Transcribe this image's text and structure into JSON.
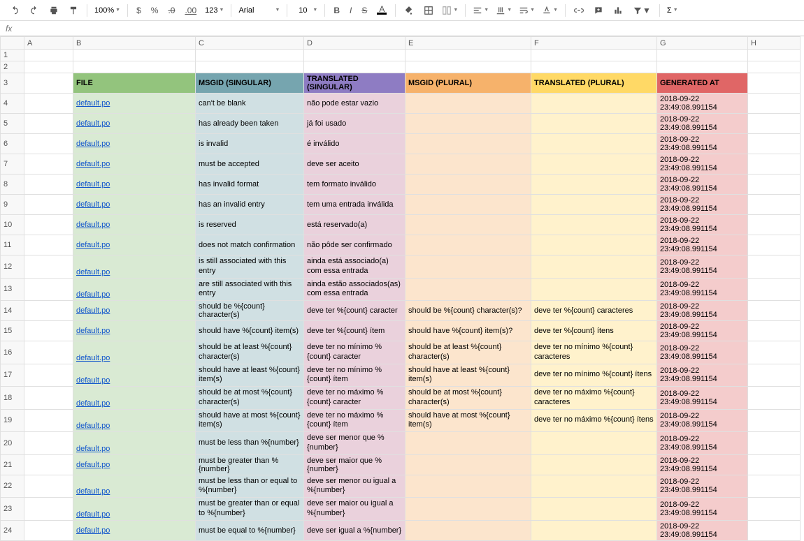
{
  "toolbar": {
    "zoom": "100%",
    "currency": "$",
    "percent": "%",
    "dec_remove": ".0",
    "dec_add": ".00",
    "numfmt": "123",
    "font_name": "Arial",
    "font_size": "10",
    "bold_label": "B",
    "italic_label": "I",
    "strike_label": "S",
    "textcolor_label": "A",
    "formula_label": "Σ"
  },
  "formula_bar": {
    "fx": "fx",
    "value": ""
  },
  "columns": [
    "",
    "A",
    "B",
    "C",
    "D",
    "E",
    "F",
    "G",
    "H"
  ],
  "headers": {
    "file": "FILE",
    "msgid_s": "MSGID (SINGULAR)",
    "trans_s": "TRANSLATED (SINGULAR)",
    "msgid_p": "MSGID (PLURAL)",
    "trans_p": "TRANSLATED (PLURAL)",
    "gen": "GENERATED AT"
  },
  "file_label": "default.po",
  "ts": "2018-09-22 23:49:08.991154",
  "rows": [
    {
      "n": 4,
      "ms": "can't be blank",
      "ts": "não pode estar vazio",
      "mp": "",
      "tp": ""
    },
    {
      "n": 5,
      "ms": "has already been taken",
      "ts": "já foi usado",
      "mp": "",
      "tp": ""
    },
    {
      "n": 6,
      "ms": "is invalid",
      "ts": "é inválido",
      "mp": "",
      "tp": ""
    },
    {
      "n": 7,
      "ms": "must be accepted",
      "ts": "deve ser aceito",
      "mp": "",
      "tp": ""
    },
    {
      "n": 8,
      "ms": "has invalid format",
      "ts": "tem formato inválido",
      "mp": "",
      "tp": ""
    },
    {
      "n": 9,
      "ms": "has an invalid entry",
      "ts": "tem uma entrada inválida",
      "mp": "",
      "tp": ""
    },
    {
      "n": 10,
      "ms": "is reserved",
      "ts": "está reservado(a)",
      "mp": "",
      "tp": ""
    },
    {
      "n": 11,
      "ms": "does not match confirmation",
      "ts": "não pôde ser confirmado",
      "mp": "",
      "tp": ""
    },
    {
      "n": 12,
      "tall": true,
      "ms": "is still associated with this entry",
      "ts": "ainda está associado(a) com essa entrada",
      "mp": "",
      "tp": ""
    },
    {
      "n": 13,
      "tall": true,
      "ms": "are still associated with this entry",
      "ts": "ainda estão associados(as) com essa entrada",
      "mp": "",
      "tp": ""
    },
    {
      "n": 14,
      "ms": "should be %{count} character(s)",
      "ts": "deve ter %{count} caracter",
      "mp": "should be %{count} character(s)?",
      "tp": "deve ter %{count} caracteres"
    },
    {
      "n": 15,
      "ms": "should have %{count} item(s)",
      "ts": "deve ter %{count} ítem",
      "mp": "should have %{count} item(s)?",
      "tp": "deve ter %{count} ítens"
    },
    {
      "n": 16,
      "tall": true,
      "ms": "should be at least %{count} character(s)",
      "ts": "deve ter no mínimo %{count} caracter",
      "mp": "should be at least %{count} character(s)",
      "tp": "deve ter no mínimo %{count} caracteres"
    },
    {
      "n": 17,
      "tall": true,
      "ms": "should have at least %{count} item(s)",
      "ts": "deve ter no mínimo %{count} ítem",
      "mp": "should have at least %{count} item(s)",
      "tp": "deve ter no mínimo %{count} ítens"
    },
    {
      "n": 18,
      "tall": true,
      "ms": "should be at most %{count} character(s)",
      "ts": "deve ter no máximo %{count} caracter",
      "mp": "should be at most %{count} character(s)",
      "tp": "deve ter no máximo %{count} caracteres"
    },
    {
      "n": 19,
      "tall": true,
      "ms": "should have at most %{count} item(s)",
      "ts": "deve ter no máximo %{count} ítem",
      "mp": "should have at most %{count} item(s)",
      "tp": "deve ter no máximo %{count} ítens"
    },
    {
      "n": 20,
      "tall": true,
      "ms": "must be less than %{number}",
      "ts": "deve ser menor que %{number}",
      "mp": "",
      "tp": ""
    },
    {
      "n": 21,
      "ms": "must be greater than %{number}",
      "ts": "deve ser maior que %{number}",
      "mp": "",
      "tp": ""
    },
    {
      "n": 22,
      "tall": true,
      "ms": "must be less than or equal to %{number}",
      "ts": "deve ser menor ou igual a %{number}",
      "mp": "",
      "tp": ""
    },
    {
      "n": 23,
      "tall": true,
      "ms": "must be greater than or equal to %{number}",
      "ts": "deve ser maior ou igual a %{number}",
      "mp": "",
      "tp": ""
    },
    {
      "n": 24,
      "ms": "must be equal to %{number}",
      "ts": "deve ser igual a %{number}",
      "mp": "",
      "tp": ""
    }
  ]
}
